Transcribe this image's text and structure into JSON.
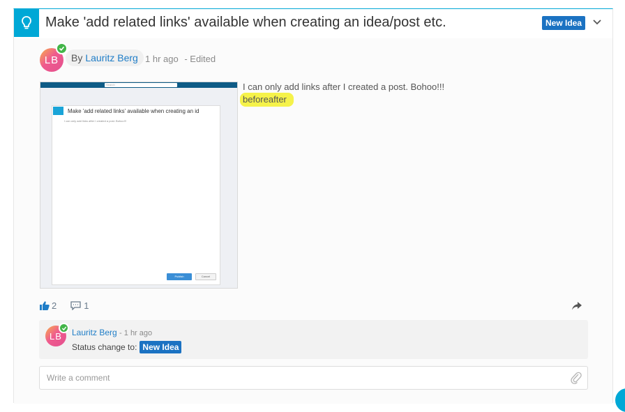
{
  "idea": {
    "title": "Make 'add related links' available when creating an idea/post etc.",
    "status": "New Idea"
  },
  "post": {
    "author_prefix": "By",
    "author_name": "Lauritz Berg",
    "avatar_initials": "LB",
    "time": "1 hr ago",
    "edited": "- Edited",
    "text": "I can only add links after I created a post. Bohoo!!!",
    "highlight_text": "beforeafter",
    "likes": "2",
    "comments": "1"
  },
  "thumbnail": {
    "search_placeholder": "Search",
    "inner_title": "Make 'add related links' available when creating an id",
    "inner_text": "I can only add links after I created a post. Bohoo!!!",
    "publish_label": "Publish",
    "cancel_label": "Cancel"
  },
  "comment": {
    "avatar_initials": "LB",
    "author_name": "Lauritz Berg",
    "time": "- 1 hr ago",
    "status_label": "Status change to:",
    "status_value": "New Idea"
  },
  "write_comment": {
    "placeholder": "Write a comment"
  },
  "colors": {
    "accent": "#00a8d6",
    "status_blue": "#1b72c2",
    "link_blue": "#1f7dc7",
    "verified_green": "#42b548",
    "highlight_yellow": "#f5f24a"
  },
  "icons": [
    "lightbulb-icon",
    "chevron-down-icon",
    "verified-check-icon",
    "thumbs-up-icon",
    "comment-icon",
    "share-icon",
    "paperclip-icon"
  ]
}
